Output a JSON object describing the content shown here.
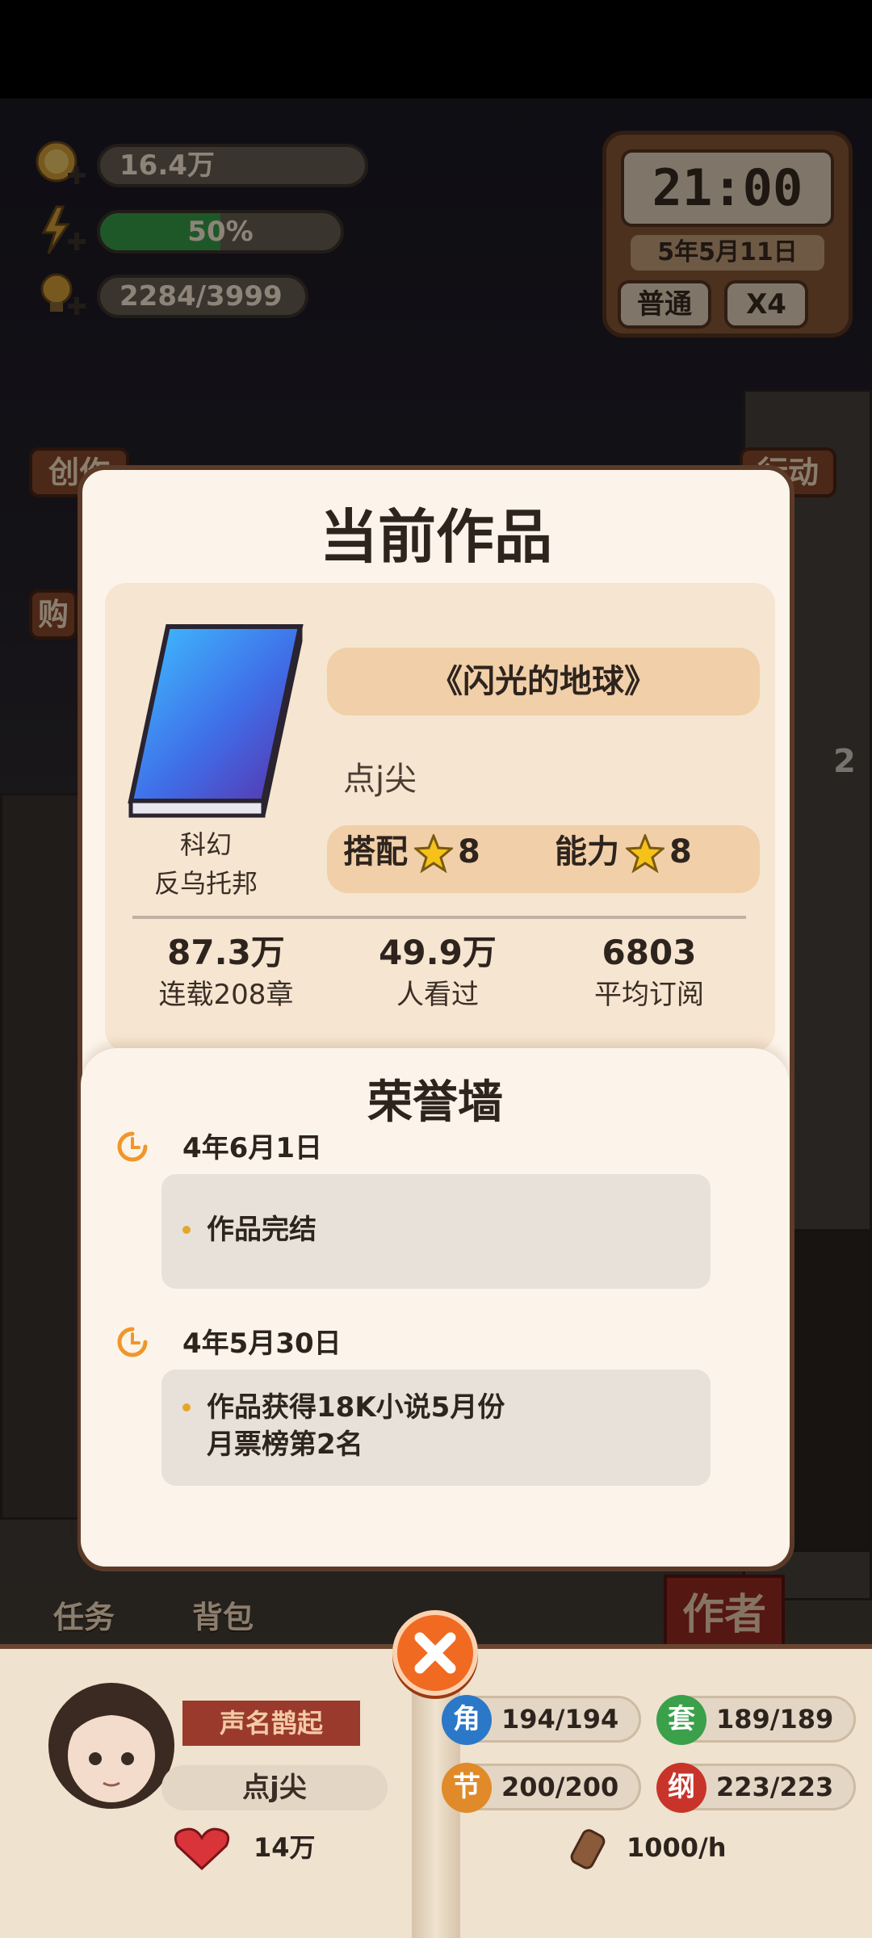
{
  "hud": {
    "money": "16.4万",
    "energy": "50%",
    "energy_fraction": 0.5,
    "inspiration": "2284/3999"
  },
  "clock": {
    "time": "21:00",
    "date": "5年5月11日",
    "mode_button": "普通",
    "speed_button": "X4"
  },
  "side": {
    "create_label": "创作",
    "buy_label": "购",
    "action_label": "行动",
    "notify_count": "2"
  },
  "modal": {
    "title": "当前作品",
    "work": {
      "title": "《闪光的地球》",
      "author": "点j尖",
      "genre": "科幻",
      "subgenre": "反乌托邦",
      "match_label": "搭配",
      "match_value": "8",
      "ability_label": "能力",
      "ability_value": "8"
    },
    "stats": [
      {
        "value": "87.3万",
        "label": "连载208章"
      },
      {
        "value": "49.9万",
        "label": "人看过"
      },
      {
        "value": "6803",
        "label": "平均订阅"
      }
    ]
  },
  "honor_wall": {
    "title": "荣誉墙",
    "events": [
      {
        "date": "4年6月1日",
        "lines": [
          "作品完结"
        ]
      },
      {
        "date": "4年5月30日",
        "lines": [
          "作品获得18K小说5月份",
          "月票榜第2名"
        ]
      }
    ]
  },
  "nav": {
    "tasks": "任务",
    "backpack": "背包",
    "author_tab": "作者"
  },
  "profile": {
    "title": "声名鹊起",
    "name": "点j尖",
    "fans": "14万",
    "resources": [
      {
        "badge": "角",
        "value": "194/194",
        "color": "#2b78c8"
      },
      {
        "badge": "套",
        "value": "189/189",
        "color": "#3aa04a"
      },
      {
        "badge": "节",
        "value": "200/200",
        "color": "#e08a2a"
      },
      {
        "badge": "纲",
        "value": "223/223",
        "color": "#c8342a"
      }
    ],
    "rate": "1000/h"
  },
  "colors": {
    "modal_bg": "#fcf4ea",
    "panel_bg": "#f6e5d0",
    "pill_bg": "#f1cfa8",
    "close_button": "#f06a22"
  }
}
